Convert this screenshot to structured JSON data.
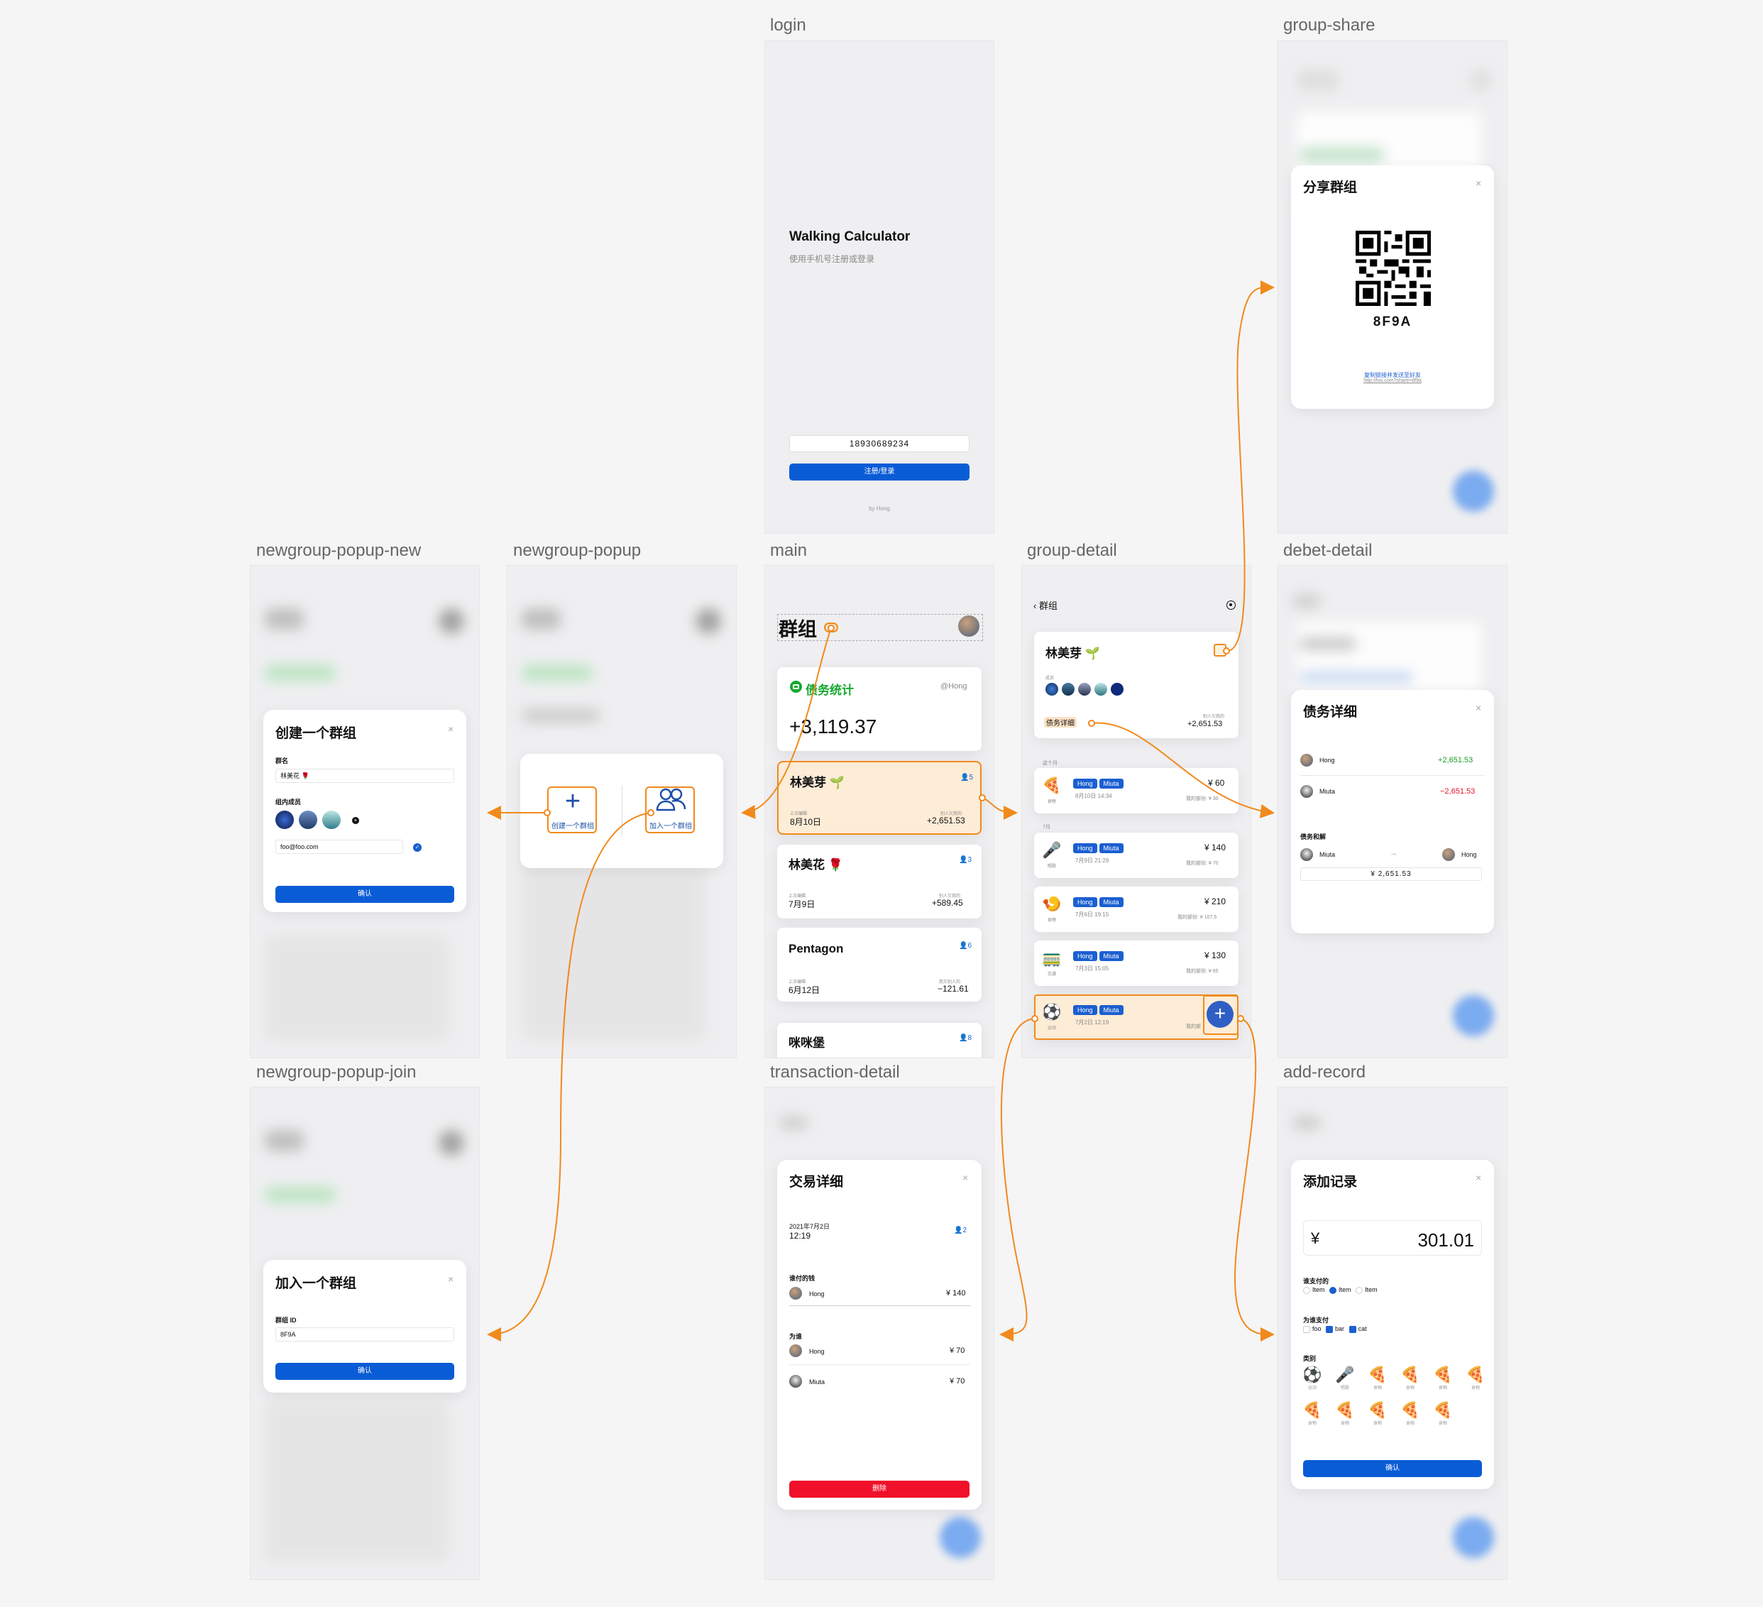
{
  "frame_labels": {
    "login": "login",
    "group_share": "group-share",
    "newgroup_popup_new": "newgroup-popup-new",
    "newgroup_popup": "newgroup-popup",
    "main": "main",
    "group_detail": "group-detail",
    "debet_detail": "debet-detail",
    "newgroup_popup_join": "newgroup-popup-join",
    "transaction_detail": "transaction-detail",
    "add_record": "add-record"
  },
  "login": {
    "title": "Walking Calculator",
    "subtitle": "使用手机号注册或登录",
    "phone_value": "18930689234",
    "submit_label": "注册/登录",
    "footer": "by Hong"
  },
  "group_share": {
    "title": "分享群组",
    "code": "8F9A",
    "link_label": "复制链接并发送至好友",
    "link_url": "http://foo.com?share=8f9a"
  },
  "main": {
    "title": "群组",
    "stats": {
      "title": "债务统计",
      "user": "@Hong",
      "amount": "+3,119.37"
    },
    "groups": [
      {
        "name": "林美芽",
        "emoji": "🌱",
        "members": "5",
        "date_label": "上次编辑",
        "date": "8月10日",
        "amount_label": "别人欠我的",
        "amount": "+2,651.53"
      },
      {
        "name": "林美花",
        "emoji": "🌹",
        "members": "3",
        "date_label": "上次编辑",
        "date": "7月9日",
        "amount_label": "别人欠我的",
        "amount": "+589.45"
      },
      {
        "name": "Pentagon",
        "emoji": "",
        "members": "6",
        "date_label": "上次编辑",
        "date": "6月12日",
        "amount_label": "我欠别人的",
        "amount": "−121.61"
      },
      {
        "name": "咪咪堡",
        "emoji": "",
        "members": "8",
        "date_label": "",
        "date": "",
        "amount_label": "",
        "amount": ""
      }
    ]
  },
  "newgroup_popup": {
    "create_label": "创建一个群组",
    "join_label": "加入一个群组"
  },
  "newgroup_new": {
    "title": "创建一个群组",
    "name_label": "群名",
    "name_value": "林美花 🌹",
    "members_label": "组内成员",
    "email_value": "foo@foo.com",
    "confirm": "确认"
  },
  "newgroup_join": {
    "title": "加入一个群组",
    "id_label": "群组 ID",
    "id_value": "8F9A",
    "confirm": "确认"
  },
  "group_detail": {
    "back_label": "群组",
    "name": "林美芽",
    "emoji": "🌱",
    "members_label": "成员",
    "debt_link": "债务详细",
    "owed_label": "别人欠我的",
    "owed_amount": "+2,651.53",
    "section_this_month": "这个月",
    "section_july": "7月",
    "records": [
      {
        "emoji": "🍕",
        "cat": "食物",
        "payer": "Hong",
        "for": "Miuta",
        "time": "8月10日 14:34",
        "amount": "¥ 60",
        "share_label": "我的部份",
        "share": "¥ 30"
      },
      {
        "emoji": "🎤",
        "cat": "唱歌",
        "payer": "Hong",
        "for": "Miuta",
        "time": "7月9日 21:29",
        "amount": "¥ 140",
        "share_label": "我的部份",
        "share": "¥ 70"
      },
      {
        "emoji": "🍤",
        "cat": "食物",
        "payer": "Hong",
        "for": "Miuta",
        "time": "7月6日 19:15",
        "amount": "¥ 210",
        "share_label": "我的部份",
        "share": "¥ 107.5"
      },
      {
        "emoji": "🚃",
        "cat": "交通",
        "payer": "Hong",
        "for": "Miuta",
        "time": "7月3日 15:05",
        "amount": "¥ 130",
        "share_label": "我的部份",
        "share": "¥ 65"
      },
      {
        "emoji": "⚽",
        "cat": "运动",
        "payer": "Hong",
        "for": "Miuta",
        "time": "7月2日 12:19",
        "amount": "",
        "share_label": "我的部",
        "share": ""
      }
    ]
  },
  "debet_detail": {
    "title": "债务详细",
    "rows": [
      {
        "name": "Hong",
        "amount": "+2,651.53"
      },
      {
        "name": "Miuta",
        "amount": "−2,651.53"
      }
    ],
    "settle_label": "债务和解",
    "settle_from": "Miuta",
    "settle_to": "Hong",
    "settle_amount": "¥ 2,651.53"
  },
  "transaction_detail": {
    "title": "交易详细",
    "date": "2021年7月2日",
    "time": "12:19",
    "members": "2",
    "paid_label": "谁付的钱",
    "payer": {
      "name": "Hong",
      "amount": "¥ 140"
    },
    "for_label": "为谁",
    "for_rows": [
      {
        "name": "Hong",
        "amount": "¥ 70"
      },
      {
        "name": "Miuta",
        "amount": "¥ 70"
      }
    ],
    "delete_label": "删除"
  },
  "add_record": {
    "title": "添加记录",
    "currency": "¥",
    "amount": "301.01",
    "payer_label": "谁支付的",
    "payer_options": [
      "Item",
      "Item",
      "Item"
    ],
    "for_label": "为谁支付",
    "for_options": [
      "foo",
      "bar",
      "cat"
    ],
    "category_label": "类别",
    "categories": [
      {
        "emoji": "⚽",
        "name": "运动"
      },
      {
        "emoji": "🎤",
        "name": "唱歌"
      },
      {
        "emoji": "🍕",
        "name": "食物"
      },
      {
        "emoji": "🍕",
        "name": "食物"
      },
      {
        "emoji": "🍕",
        "name": "食物"
      },
      {
        "emoji": "🍕",
        "name": "食物"
      },
      {
        "emoji": "🍕",
        "name": "食物"
      },
      {
        "emoji": "🍕",
        "name": "食物"
      },
      {
        "emoji": "🍕",
        "name": "食物"
      },
      {
        "emoji": "🍕",
        "name": "食物"
      },
      {
        "emoji": "🍕",
        "name": "食物"
      }
    ],
    "confirm": "确认"
  },
  "colors": {
    "accent": "#0a5cd6",
    "positive": "#1a9e2a",
    "negative": "#e8102a",
    "highlight": "#f08a1c",
    "stats_green": "#16a82e"
  }
}
